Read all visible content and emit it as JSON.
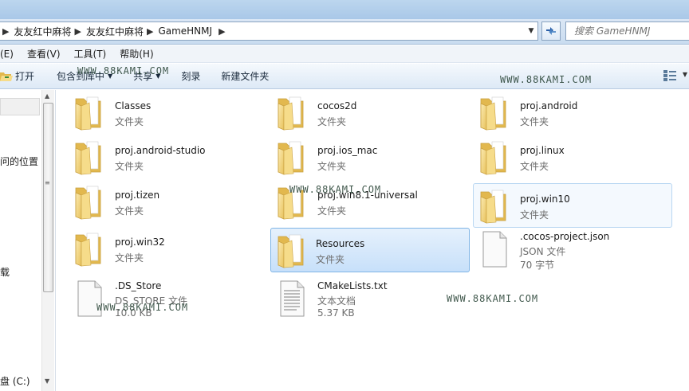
{
  "address": {
    "crumbs": [
      "友友红中麻将",
      "友友红中麻将",
      "GameHNMJ"
    ],
    "search_placeholder": "搜索 GameHNMJ"
  },
  "menu": {
    "items": [
      "(E)",
      "查看(V)",
      "工具(T)",
      "帮助(H)"
    ]
  },
  "toolbar": {
    "open": "打开",
    "include": "包含到库中",
    "share": "共享",
    "burn": "刻录",
    "new_folder": "新建文件夹"
  },
  "nav": {
    "items": [
      "问的位置",
      "载",
      "盘 (C:)"
    ]
  },
  "files": [
    {
      "name": "Classes",
      "type": "文件夹"
    },
    {
      "name": "cocos2d",
      "type": "文件夹"
    },
    {
      "name": "proj.android",
      "type": "文件夹"
    },
    {
      "name": "proj.android-studio",
      "type": "文件夹"
    },
    {
      "name": "proj.ios_mac",
      "type": "文件夹"
    },
    {
      "name": "proj.linux",
      "type": "文件夹"
    },
    {
      "name": "proj.tizen",
      "type": "文件夹"
    },
    {
      "name": "proj.win8.1-universal",
      "type": "文件夹"
    },
    {
      "name": "proj.win10",
      "type": "文件夹"
    },
    {
      "name": "proj.win32",
      "type": "文件夹"
    },
    {
      "name": "Resources",
      "type": "文件夹"
    },
    {
      "name": ".cocos-project.json",
      "type": "JSON 文件",
      "size": "70 字节"
    },
    {
      "name": ".DS_Store",
      "type": "DS_STORE 文件",
      "size": "10.0 KB"
    },
    {
      "name": "CMakeLists.txt",
      "type": "文本文档",
      "size": "5.37 KB"
    }
  ],
  "watermark": "WWW.88KAMI.COM",
  "colors": {
    "selection": "#cce4fa",
    "folder": "#f3d77a"
  }
}
